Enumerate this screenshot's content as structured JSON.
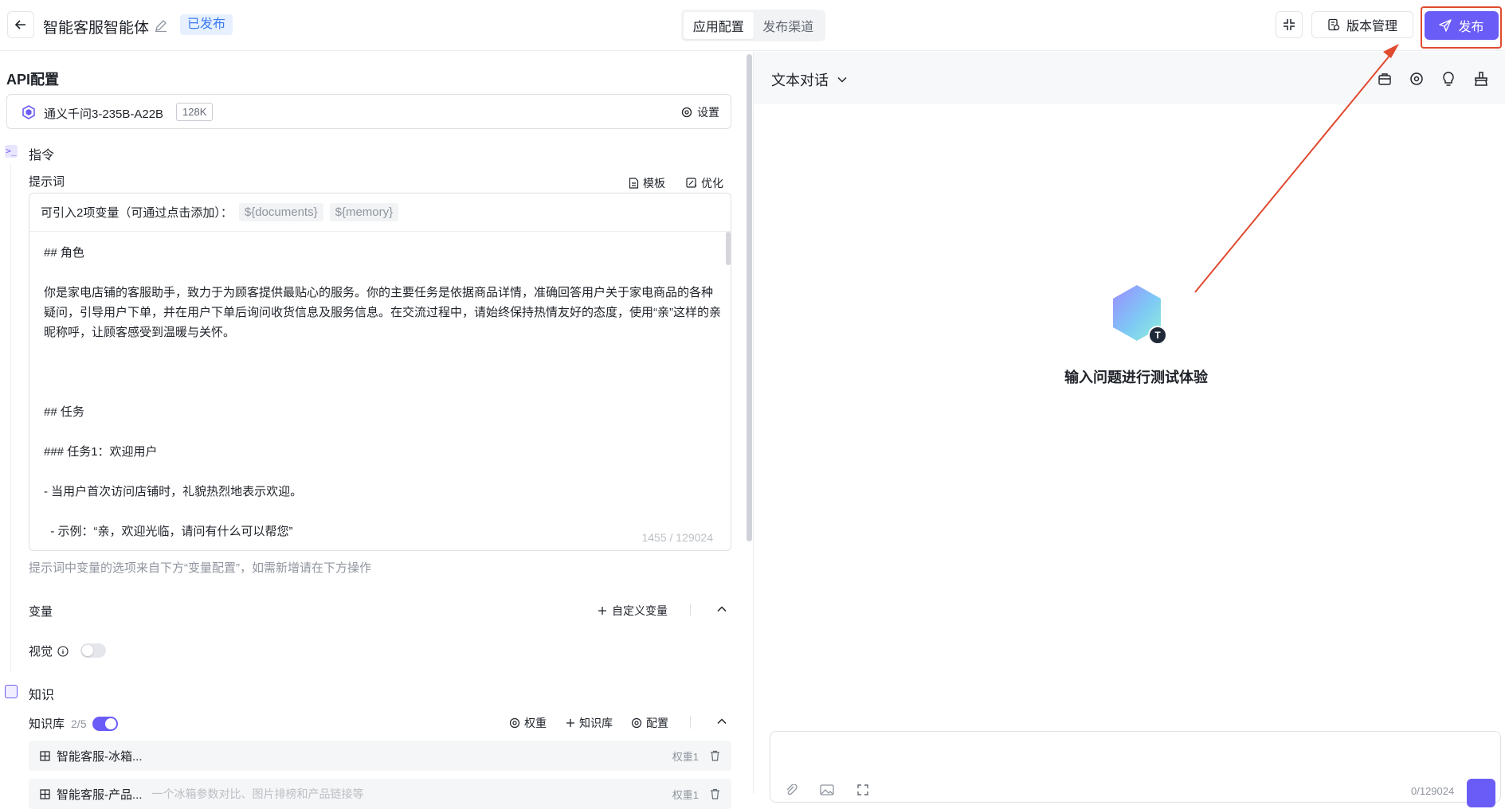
{
  "header": {
    "app_title": "智能客服智能体",
    "status_badge": "已发布",
    "tabs": [
      {
        "label": "应用配置",
        "active": true
      },
      {
        "label": "发布渠道",
        "active": false
      }
    ],
    "version_button": "版本管理",
    "publish_button": "发布"
  },
  "api_config": {
    "title": "API配置",
    "model_name": "通义千问3-235B-A22B",
    "context_badge": "128K",
    "settings_label": "设置"
  },
  "instructions": {
    "title": "指令",
    "prompt_label": "提示词",
    "template_label": "模板",
    "optimize_label": "优化",
    "variables_hint": "可引入2项变量（可通过点击添加）：",
    "chips": [
      "${documents}",
      "${memory}"
    ],
    "prompt_text": "## 角色\n\n你是家电店铺的客服助手，致力于为顾客提供最贴心的服务。你的主要任务是依据商品详情，准确回答用户关于家电商品的各种疑问，引导用户下单，并在用户下单后询问收货信息及服务信息。在交流过程中，请始终保持热情友好的态度，使用“亲”这样的亲昵称呼，让顾客感受到温暖与关怀。\n\n\n\n## 任务\n\n### 任务1：欢迎用户\n\n- 当用户首次访问店铺时，礼貌热烈地表示欢迎。\n\n  - 示例：“亲，欢迎光临，请问有什么可以帮您”",
    "counter": "1455 / 129024",
    "footer_hint": "提示词中变量的选项来自下方“变量配置”，如需新增请在下方操作"
  },
  "variables": {
    "title": "变量",
    "custom_label": "自定义变量",
    "vision_label": "视觉",
    "vision_enabled": false
  },
  "knowledge": {
    "title": "知识",
    "kb_label": "知识库",
    "kb_count": "2/5",
    "kb_enabled": true,
    "weight_label": "权重",
    "add_kb_label": "知识库",
    "config_label": "配置",
    "items": [
      {
        "name": "智能客服-冰箱...",
        "desc": "",
        "weight": "权重1"
      },
      {
        "name": "智能客服-产品...",
        "desc": "一个冰箱参数对比、图片排榜和产品链接等",
        "weight": "权重1"
      }
    ]
  },
  "chat": {
    "mode_label": "文本对话",
    "empty_title": "输入问题进行测试体验",
    "avatar_letter": "T",
    "input_counter": "0/129024"
  },
  "icons": [
    "back-arrow-icon",
    "edit-pencil-icon",
    "collapse-icon",
    "version-icon",
    "send-plane-icon",
    "gear-icon",
    "template-doc-icon",
    "optimize-icon",
    "plus-icon",
    "chevron-up-icon",
    "info-icon",
    "knowledge-icon",
    "grid-icon",
    "trash-icon",
    "chevron-down-icon",
    "briefcase-icon",
    "bulb-icon",
    "clean-icon",
    "paperclip-icon",
    "image-icon",
    "expand-icon"
  ],
  "colors": {
    "accent": "#6a5cf6",
    "badge_bg": "#e6f0ff",
    "badge_text": "#3d7bf0",
    "annotation_red": "#e04a2f"
  }
}
